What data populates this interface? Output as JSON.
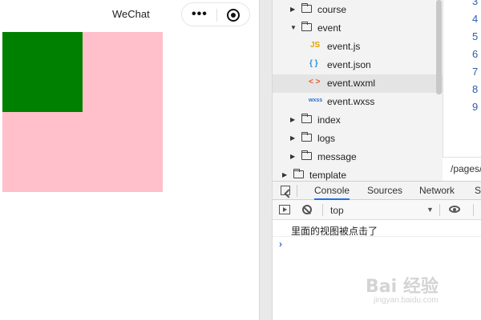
{
  "simulator": {
    "title": "WeChat",
    "menu_dots": "•••",
    "pink_color": "#ffc0cb",
    "green_color": "#008000"
  },
  "file_tree": {
    "items": [
      {
        "label": "course",
        "type": "folder",
        "state": "collapsed"
      },
      {
        "label": "event",
        "type": "folder",
        "state": "expanded"
      },
      {
        "label": "event.js",
        "type": "file",
        "icon": "js-file-icon",
        "icon_text": "JS"
      },
      {
        "label": "event.json",
        "type": "file",
        "icon": "json-file-icon",
        "icon_text": "{ }"
      },
      {
        "label": "event.wxml",
        "type": "file",
        "icon": "wxml-file-icon",
        "icon_text": "< >",
        "selected": true
      },
      {
        "label": "event.wxss",
        "type": "file",
        "icon": "wxss-file-icon",
        "icon_text": "wxss"
      },
      {
        "label": "index",
        "type": "folder",
        "state": "collapsed"
      },
      {
        "label": "logs",
        "type": "folder",
        "state": "collapsed"
      },
      {
        "label": "message",
        "type": "folder",
        "state": "collapsed"
      },
      {
        "label": "template",
        "type": "folder",
        "state": "collapsed"
      }
    ]
  },
  "editor": {
    "line_numbers": [
      "3",
      "4",
      "5",
      "6",
      "7",
      "8",
      "9"
    ],
    "path": "/pages/"
  },
  "devtools": {
    "tabs": [
      "Console",
      "Sources",
      "Network",
      "S"
    ],
    "active_tab": "Console",
    "context": "top",
    "log": "里面的视图被点击了",
    "prompt": "›"
  },
  "watermark": {
    "text": "Bai 经验",
    "sub": "jingyan.baidu.com"
  }
}
